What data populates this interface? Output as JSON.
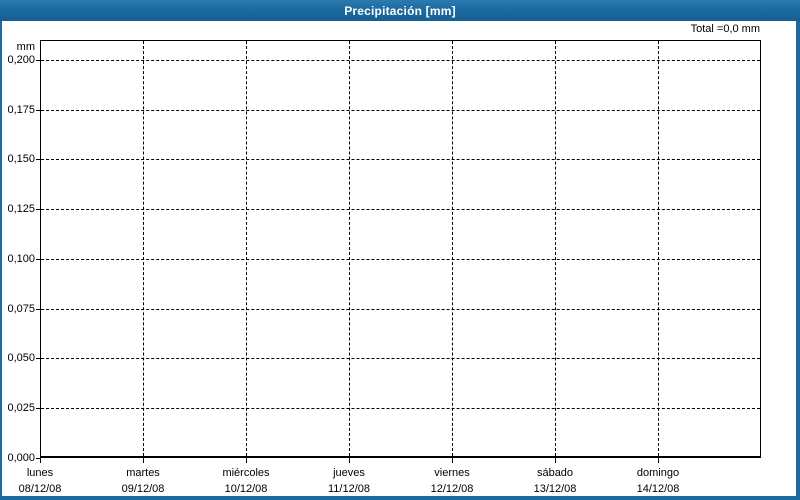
{
  "title_bar": {
    "title": "Precipitación [mm]"
  },
  "chart": {
    "total_label": "Total =0,0 mm",
    "y_axis_unit": "mm"
  },
  "chart_data": {
    "type": "bar",
    "title": "Precipitación [mm]",
    "ylabel": "mm",
    "xlabel": "",
    "ylim": [
      0,
      0.21
    ],
    "grid": "dashed",
    "legend": "none",
    "total_label": "Total =0,0 mm",
    "total_value_mm": "0,0",
    "y_ticks": [
      {
        "value": 0.0,
        "label": "0,000"
      },
      {
        "value": 0.025,
        "label": "0,025"
      },
      {
        "value": 0.05,
        "label": "0,050"
      },
      {
        "value": 0.075,
        "label": "0,075"
      },
      {
        "value": 0.1,
        "label": "0,100"
      },
      {
        "value": 0.125,
        "label": "0,125"
      },
      {
        "value": 0.15,
        "label": "0,150"
      },
      {
        "value": 0.175,
        "label": "0,175"
      },
      {
        "value": 0.2,
        "label": "0,200"
      }
    ],
    "categories": [
      {
        "day": "lunes",
        "date": "08/12/08"
      },
      {
        "day": "martes",
        "date": "09/12/08"
      },
      {
        "day": "miércoles",
        "date": "10/12/08"
      },
      {
        "day": "jueves",
        "date": "11/12/08"
      },
      {
        "day": "viernes",
        "date": "12/12/08"
      },
      {
        "day": "sábado",
        "date": "13/12/08"
      },
      {
        "day": "domingo",
        "date": "14/12/08"
      }
    ],
    "values": [
      0,
      0,
      0,
      0,
      0,
      0,
      0
    ],
    "colors": {
      "title_bar_blue": "#1C6A9F",
      "frame_border_blue": "#1C6A9F",
      "grid_line": "#000000",
      "background": "#FFFFFF",
      "title_text": "#FFFFFF"
    }
  }
}
